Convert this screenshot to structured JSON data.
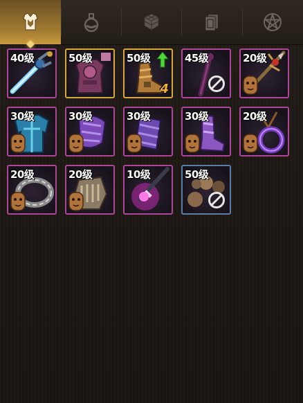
{
  "tabs": [
    {
      "name": "equipment-tab",
      "icon": "armor-icon",
      "active": true
    },
    {
      "name": "potion-tab",
      "icon": "potion-icon",
      "active": false
    },
    {
      "name": "materials-tab",
      "icon": "cubes-icon",
      "active": false
    },
    {
      "name": "cards-tab",
      "icon": "cards-icon",
      "active": false
    },
    {
      "name": "pentagram-tab",
      "icon": "pentagram-icon",
      "active": false
    }
  ],
  "items": [
    {
      "level": "40级",
      "icon": "sword-icon",
      "frame": "purple",
      "face": false,
      "banned": false,
      "upgrade": false,
      "count": ""
    },
    {
      "level": "50级",
      "icon": "chest-armor-icon",
      "frame": "gold",
      "face": false,
      "banned": false,
      "upgrade": false,
      "count": ""
    },
    {
      "level": "50级",
      "icon": "boots-icon",
      "frame": "gold",
      "face": false,
      "banned": false,
      "upgrade": true,
      "count": "4"
    },
    {
      "level": "45级",
      "icon": "staff-icon",
      "frame": "purple",
      "face": false,
      "banned": true,
      "upgrade": false,
      "count": ""
    },
    {
      "level": "20级",
      "icon": "spear-icon",
      "frame": "purple",
      "face": true,
      "banned": false,
      "upgrade": false,
      "count": ""
    },
    {
      "level": "30级",
      "icon": "tunic-icon",
      "frame": "purple",
      "face": true,
      "banned": false,
      "upgrade": false,
      "count": ""
    },
    {
      "level": "30级",
      "icon": "shoulder-armor-icon",
      "frame": "purple",
      "face": true,
      "banned": false,
      "upgrade": false,
      "count": ""
    },
    {
      "level": "30级",
      "icon": "bracer-icon",
      "frame": "purple",
      "face": true,
      "banned": false,
      "upgrade": false,
      "count": ""
    },
    {
      "level": "30级",
      "icon": "greave-icon",
      "frame": "purple",
      "face": true,
      "banned": false,
      "upgrade": false,
      "count": ""
    },
    {
      "level": "20级",
      "icon": "amulet-ring-icon",
      "frame": "purple",
      "face": true,
      "banned": false,
      "upgrade": false,
      "count": ""
    },
    {
      "level": "20级",
      "icon": "chain-bracelet-icon",
      "frame": "purple",
      "face": true,
      "banned": false,
      "upgrade": false,
      "count": ""
    },
    {
      "level": "20级",
      "icon": "gauntlet-icon",
      "frame": "purple",
      "face": true,
      "banned": false,
      "upgrade": false,
      "count": ""
    },
    {
      "level": "10级",
      "icon": "magic-dagger-icon",
      "frame": "purple",
      "face": false,
      "banned": false,
      "upgrade": false,
      "count": ""
    },
    {
      "level": "50级",
      "icon": "orbs-icon",
      "frame": "blue",
      "face": false,
      "banned": true,
      "upgrade": false,
      "count": ""
    }
  ],
  "colors": {
    "frame_purple": "#b0469a",
    "frame_gold": "#d9a83a",
    "frame_blue": "#5a7ea8",
    "tab_active": "#c99a3c",
    "count_text": "#f1b02a"
  }
}
